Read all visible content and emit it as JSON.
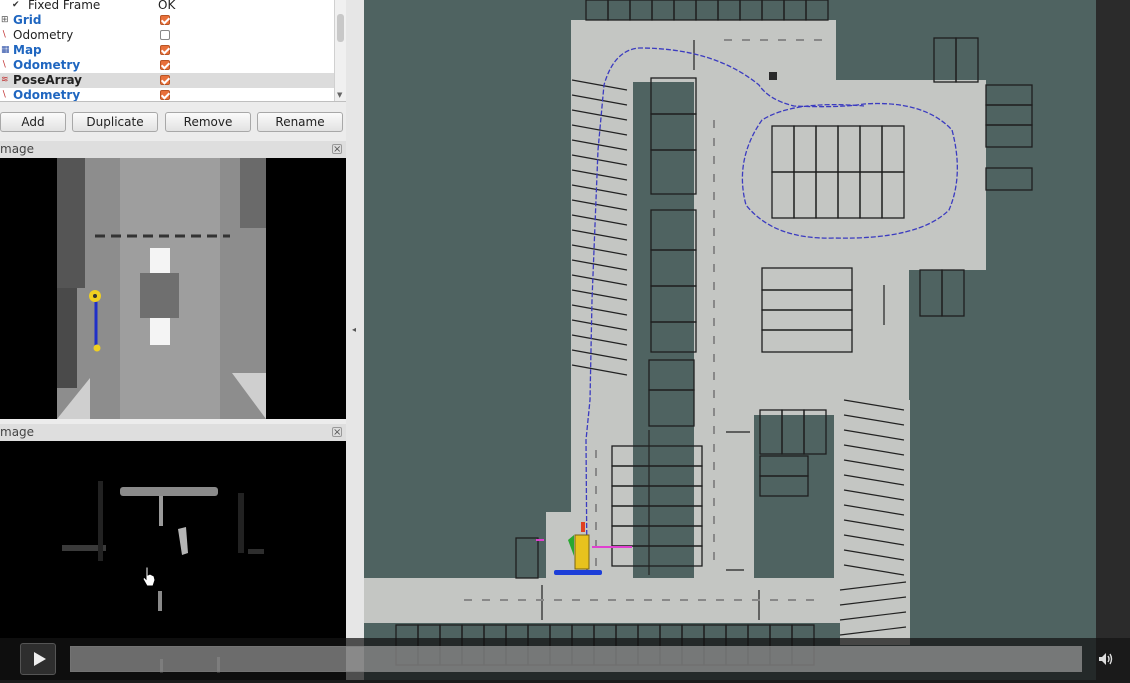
{
  "displays_panel": {
    "rows": [
      {
        "icon": "check-icon",
        "name": "Fixed Frame",
        "value": "OK",
        "style": "normal"
      },
      {
        "icon": "grid-icon",
        "name": "Grid",
        "checked": true,
        "style": "blue"
      },
      {
        "icon": "odometry-icon",
        "name": "Odometry",
        "checked": false,
        "style": "normal"
      },
      {
        "icon": "map-icon",
        "name": "Map",
        "checked": true,
        "style": "blue"
      },
      {
        "icon": "odometry-icon",
        "name": "Odometry",
        "checked": true,
        "style": "blue"
      },
      {
        "icon": "pose-array-icon",
        "name": "PoseArray",
        "checked": true,
        "style": "bold-selected"
      },
      {
        "icon": "odometry-icon",
        "name": "Odometry",
        "checked": true,
        "style": "blue"
      }
    ]
  },
  "buttons": {
    "add": "Add",
    "duplicate": "Duplicate",
    "remove": "Remove",
    "rename": "Rename"
  },
  "image_panel_top": {
    "title": "mage",
    "close": "×"
  },
  "image_panel_bottom": {
    "title": "mage",
    "close": "×"
  },
  "colors": {
    "map_background": "#4f6361",
    "free_space": "#c4c6c3",
    "path": "#3b3bc0",
    "panel": "#ececec",
    "accent_checkbox": "#e8703a"
  },
  "video_controls": {
    "play_icon": "play-icon",
    "volume_icon": "volume-icon"
  }
}
